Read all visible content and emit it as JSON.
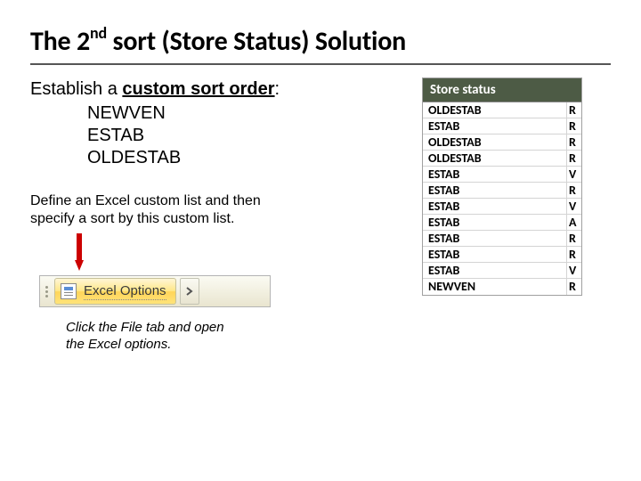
{
  "title": {
    "pre": "The 2",
    "sup": "nd",
    "post": " sort (Store Status) Solution"
  },
  "left": {
    "intro_a": "Establish a ",
    "intro_b": "custom sort order",
    "intro_c": ":",
    "order": [
      "NEWVEN",
      "ESTAB",
      "OLDESTAB"
    ],
    "define": "Define an Excel custom list and then specify a sort by this custom list.",
    "button_label": "Excel Options",
    "caption": "Click the File tab and open the Excel options."
  },
  "table": {
    "header": "Store status",
    "rows": [
      {
        "a": "OLDESTAB",
        "b": "R"
      },
      {
        "a": "ESTAB",
        "b": "R"
      },
      {
        "a": "OLDESTAB",
        "b": "R"
      },
      {
        "a": "OLDESTAB",
        "b": "R"
      },
      {
        "a": "ESTAB",
        "b": "V"
      },
      {
        "a": "ESTAB",
        "b": "R"
      },
      {
        "a": "ESTAB",
        "b": "V"
      },
      {
        "a": "ESTAB",
        "b": "A"
      },
      {
        "a": "ESTAB",
        "b": "R"
      },
      {
        "a": "ESTAB",
        "b": "R"
      },
      {
        "a": "ESTAB",
        "b": "V"
      },
      {
        "a": "NEWVEN",
        "b": "R"
      }
    ]
  }
}
